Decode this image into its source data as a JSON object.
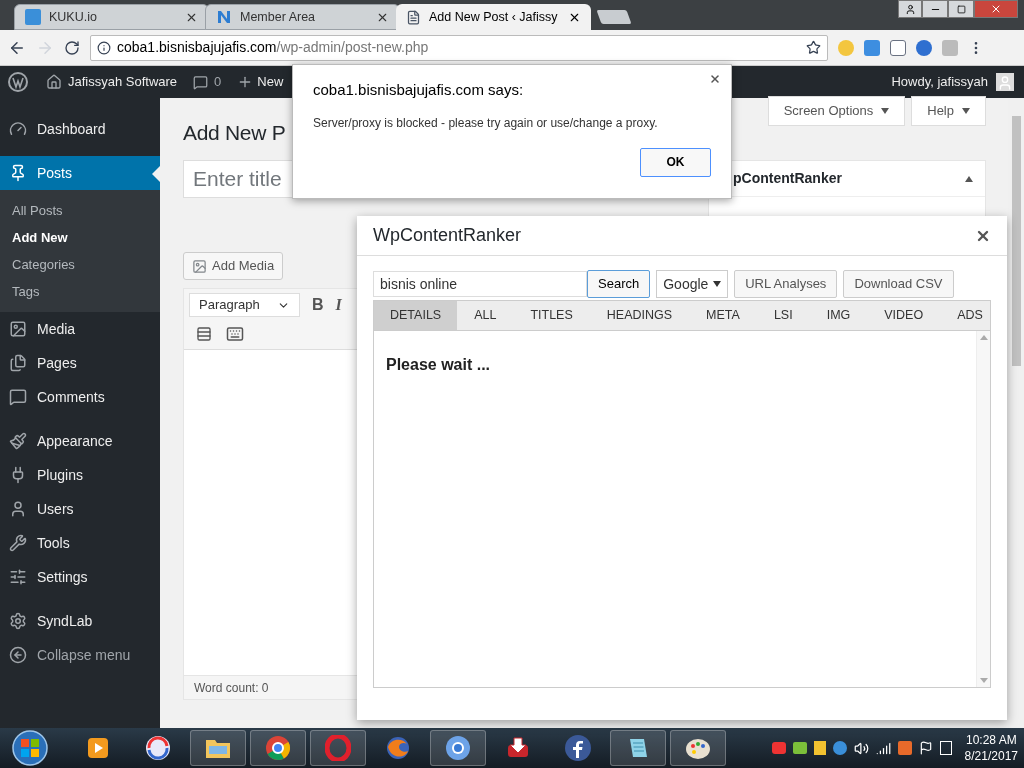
{
  "browser": {
    "tabs": [
      {
        "title": "KUKU.io",
        "selected": false
      },
      {
        "title": "Member Area",
        "selected": false
      },
      {
        "title": "Add New Post ‹ Jafissy",
        "selected": true
      }
    ],
    "url": {
      "host": "coba1.bisnisbajujafis.com",
      "path": "/wp-admin/post-new.php"
    }
  },
  "admin_bar": {
    "site": "Jafissyah Software",
    "comments": "0",
    "new": "New",
    "howdy": "Howdy, jafissyah"
  },
  "sidebar": {
    "groups": [
      [
        {
          "label": "Dashboard",
          "selected": false
        }
      ],
      [
        {
          "label": "Posts",
          "selected": true,
          "expanded": true,
          "children": [
            {
              "label": "All Posts",
              "selected": false
            },
            {
              "label": "Add New",
              "selected": true
            },
            {
              "label": "Categories",
              "selected": false
            },
            {
              "label": "Tags",
              "selected": false
            }
          ]
        },
        {
          "label": "Media",
          "selected": false
        },
        {
          "label": "Pages",
          "selected": false
        },
        {
          "label": "Comments",
          "selected": false
        }
      ],
      [
        {
          "label": "Appearance",
          "selected": false
        },
        {
          "label": "Plugins",
          "selected": false
        },
        {
          "label": "Users",
          "selected": false
        },
        {
          "label": "Tools",
          "selected": false
        },
        {
          "label": "Settings",
          "selected": false
        }
      ],
      [
        {
          "label": "SyndLab",
          "selected": false
        },
        {
          "label": "Collapse menu",
          "selected": false
        }
      ]
    ]
  },
  "page": {
    "heading": "Add New P",
    "title_placeholder": "Enter title",
    "add_media": "Add Media",
    "format": "Paragraph",
    "bold": "B",
    "italic": "I",
    "word_count": "Word count: 0",
    "screen_options": "Screen Options",
    "help": "Help",
    "metabox_title": "pContentRanker"
  },
  "alert": {
    "origin": "coba1.bisnisbajujafis.com says:",
    "message": "Server/proxy is blocked - please try again or use/change a proxy.",
    "ok": "OK"
  },
  "ranker": {
    "title": "WpContentRanker",
    "search_value": "bisnis online",
    "search_button": "Search",
    "engine": "Google",
    "buttons": [
      "URL Analyses",
      "Download CSV"
    ],
    "tabs": [
      {
        "label": "DETAILS",
        "selected": true
      },
      {
        "label": "ALL",
        "selected": false
      },
      {
        "label": "TITLES",
        "selected": false
      },
      {
        "label": "HEADINGS",
        "selected": false
      },
      {
        "label": "META",
        "selected": false
      },
      {
        "label": "LSI",
        "selected": false
      },
      {
        "label": "IMG",
        "selected": false
      },
      {
        "label": "VIDEO",
        "selected": false
      },
      {
        "label": "ADS",
        "selected": false
      }
    ],
    "status": "Please wait ..."
  },
  "taskbar": {
    "apps": [
      {
        "running": false
      },
      {
        "running": false
      },
      {
        "running": true
      },
      {
        "running": true
      },
      {
        "running": true
      },
      {
        "running": false
      },
      {
        "running": true
      },
      {
        "running": false
      },
      {
        "running": false
      },
      {
        "running": true
      },
      {
        "running": true
      }
    ],
    "time": "10:28 AM",
    "date": "8/21/2017"
  }
}
